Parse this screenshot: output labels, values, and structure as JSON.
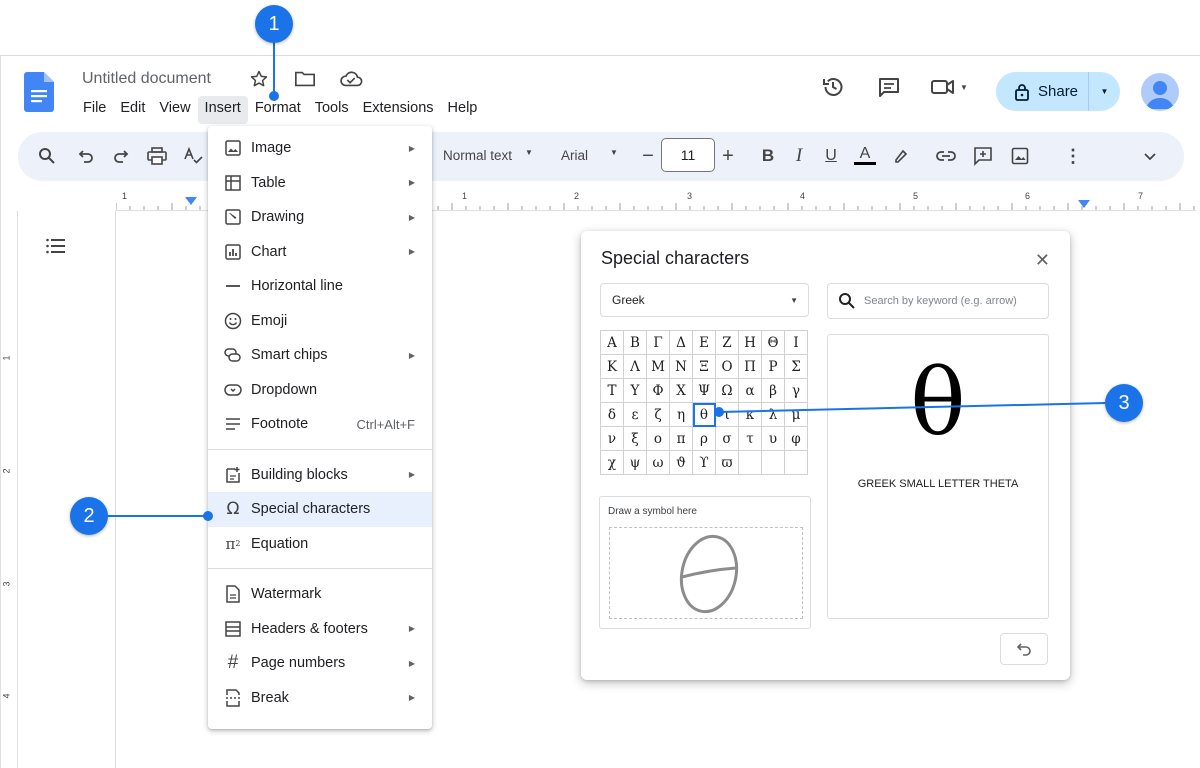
{
  "document": {
    "title": "Untitled document"
  },
  "menubar": [
    "File",
    "Edit",
    "View",
    "Insert",
    "Format",
    "Tools",
    "Extensions",
    "Help"
  ],
  "header_right": {
    "share_label": "Share"
  },
  "toolbar": {
    "style": "Normal text",
    "font": "Arial",
    "font_size": "11"
  },
  "ruler": {
    "h_numbers": [
      "1",
      "1",
      "2",
      "3",
      "4",
      "5",
      "6",
      "7"
    ],
    "v_numbers": [
      "1",
      "2",
      "3",
      "4"
    ]
  },
  "insert_menu": {
    "items": [
      {
        "label": "Image",
        "icon": "image-icon",
        "submenu": true
      },
      {
        "label": "Table",
        "icon": "table-icon",
        "submenu": true
      },
      {
        "label": "Drawing",
        "icon": "drawing-icon",
        "submenu": true
      },
      {
        "label": "Chart",
        "icon": "chart-icon",
        "submenu": true
      },
      {
        "label": "Horizontal line",
        "icon": "horizontal-line-icon",
        "submenu": false
      },
      {
        "label": "Emoji",
        "icon": "emoji-icon",
        "submenu": false
      },
      {
        "label": "Smart chips",
        "icon": "smart-chips-icon",
        "submenu": true
      },
      {
        "label": "Dropdown",
        "icon": "dropdown-icon",
        "submenu": false
      },
      {
        "label": "Footnote",
        "icon": "footnote-icon",
        "shortcut": "Ctrl+Alt+F"
      },
      {
        "label": "Building blocks",
        "icon": "building-blocks-icon",
        "submenu": true
      },
      {
        "label": "Special characters",
        "icon": "omega-icon",
        "submenu": false,
        "highlighted": true
      },
      {
        "label": "Equation",
        "icon": "pi-icon",
        "submenu": false
      },
      {
        "label": "Watermark",
        "icon": "watermark-icon",
        "submenu": false
      },
      {
        "label": "Headers & footers",
        "icon": "headers-footers-icon",
        "submenu": true
      },
      {
        "label": "Page numbers",
        "icon": "hash-icon",
        "submenu": true
      },
      {
        "label": "Break",
        "icon": "break-icon",
        "submenu": true
      }
    ]
  },
  "special_characters": {
    "title": "Special characters",
    "category": "Greek",
    "search_placeholder": "Search by keyword (e.g. arrow)",
    "grid": [
      [
        "Α",
        "Β",
        "Γ",
        "Δ",
        "Ε",
        "Ζ",
        "Η",
        "Θ",
        "Ι"
      ],
      [
        "Κ",
        "Λ",
        "Μ",
        "Ν",
        "Ξ",
        "Ο",
        "Π",
        "Ρ",
        "Σ"
      ],
      [
        "Τ",
        "Υ",
        "Φ",
        "Χ",
        "Ψ",
        "Ω",
        "α",
        "β",
        "γ"
      ],
      [
        "δ",
        "ε",
        "ζ",
        "η",
        "θ",
        "ι",
        "κ",
        "λ",
        "μ"
      ],
      [
        "ν",
        "ξ",
        "ο",
        "π",
        "ρ",
        "σ",
        "τ",
        "υ",
        "φ"
      ],
      [
        "χ",
        "ψ",
        "ω",
        "ϑ",
        "ϒ",
        "ϖ",
        "",
        "",
        ""
      ]
    ],
    "selected_char": "θ",
    "preview_char": "θ",
    "preview_name": "GREEK SMALL LETTER THETA",
    "draw_label": "Draw a symbol here"
  },
  "annotations": [
    "1",
    "2",
    "3"
  ],
  "colors": {
    "accent": "#1a73e8",
    "share_bg": "#c2e7ff",
    "toolbar_bg": "#edf2fa",
    "highlight": "#e8f0fe"
  }
}
